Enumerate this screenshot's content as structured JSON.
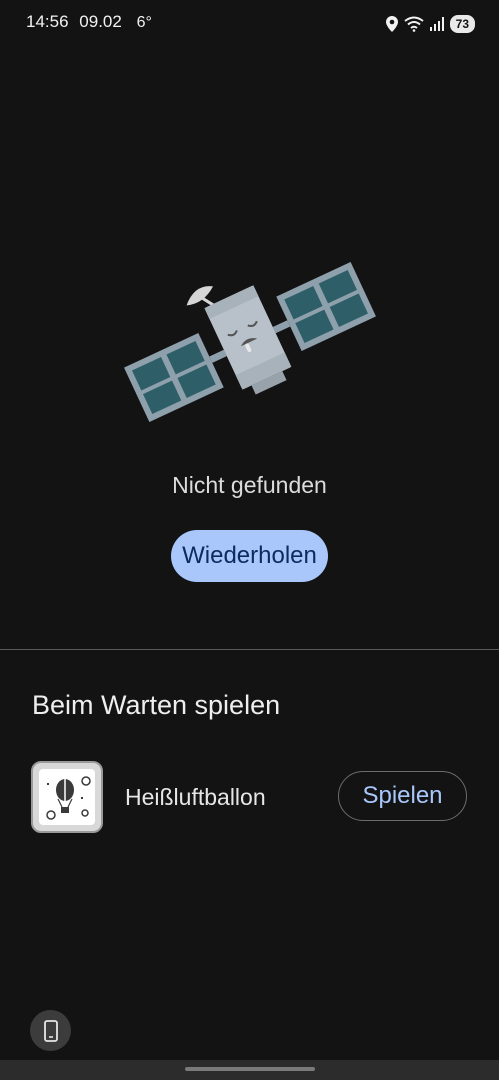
{
  "status_bar": {
    "time": "14:56",
    "date": "09.02",
    "temperature": "6°",
    "battery": "73"
  },
  "error": {
    "message": "Nicht gefunden",
    "retry_label": "Wiederholen"
  },
  "games": {
    "section_title": "Beim Warten spielen",
    "items": [
      {
        "title": "Heißluftballon",
        "play_label": "Spielen"
      }
    ]
  },
  "colors": {
    "background": "#131313",
    "accent": "#a9c7fb",
    "retry_text": "#0f2a5c"
  },
  "icons": {
    "status": [
      "location-icon",
      "wifi-icon",
      "signal-icon",
      "battery-icon"
    ],
    "illustration": "sleeping-satellite-illustration",
    "game": "hot-air-balloon-game-icon",
    "bottom": "phone-icon"
  }
}
